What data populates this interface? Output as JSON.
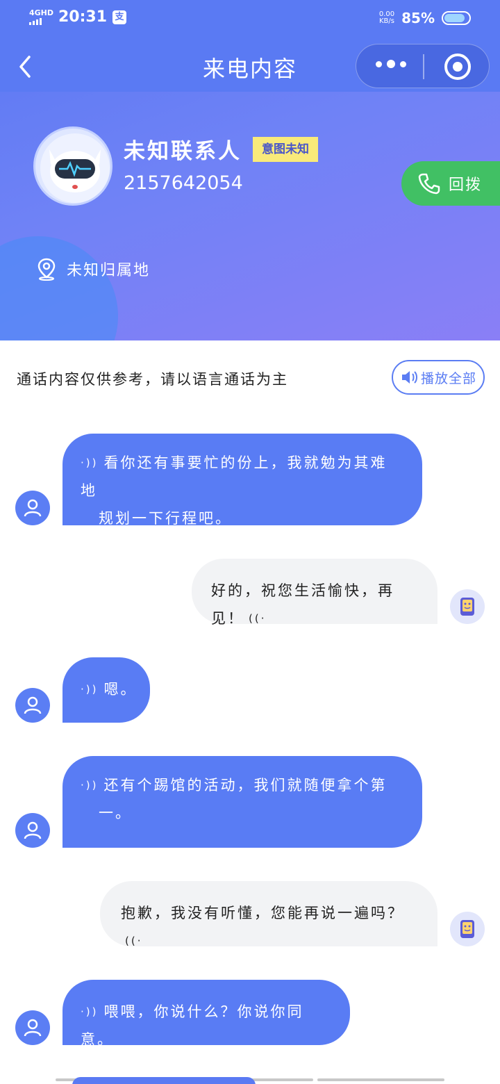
{
  "status_bar": {
    "network": "4GHD",
    "time": "20:31",
    "app_badge": "支",
    "net_speed_value": "0.00",
    "net_speed_unit": "KB/s",
    "battery": "85%"
  },
  "nav": {
    "title": "来电内容"
  },
  "contact": {
    "name": "未知联系人",
    "intent_badge": "意图未知",
    "phone": "2157642054",
    "callback_label": "回拨",
    "location": "未知归属地"
  },
  "notice": {
    "text": "通话内容仅供参考，请以语言通话为主",
    "play_all_label": "播放全部"
  },
  "messages": [
    {
      "side": "in",
      "lines": [
        "看你还有事要忙的份上，我就勉为其难地",
        "规划一下行程吧。"
      ]
    },
    {
      "side": "out",
      "lines": [
        "好的，祝您生活愉快，再见！"
      ]
    },
    {
      "side": "in",
      "lines": [
        "嗯。"
      ]
    },
    {
      "side": "in",
      "lines": [
        "还有个踢馆的活动，我们就随便拿个第",
        "一。"
      ]
    },
    {
      "side": "out",
      "lines": [
        "抱歉，我没有听懂，您能再说一遍吗？"
      ]
    },
    {
      "side": "in",
      "lines": [
        "喂喂，你说什么？你说你同意。"
      ]
    }
  ],
  "colors": {
    "primary": "#597cf4",
    "green": "#41c064",
    "badge_yellow": "#f9ea7a"
  }
}
